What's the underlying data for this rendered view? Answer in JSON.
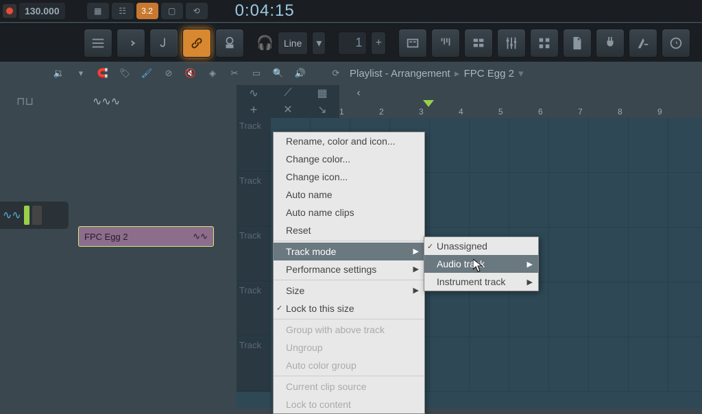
{
  "topbar": {
    "tempo": "130.000",
    "time_display": "0:04:15",
    "pattern_btn": "3.2"
  },
  "toolbar": {
    "line_mode": "Line",
    "pattern_number": "1",
    "plus": "+"
  },
  "subheader": {
    "title_prefix": "Playlist - Arrangement",
    "title_clip": "FPC Egg 2"
  },
  "clip": {
    "name": "FPC Egg 2"
  },
  "ruler": {
    "ticks": [
      "1",
      "2",
      "3",
      "4",
      "5",
      "6",
      "7",
      "8",
      "9"
    ]
  },
  "tracks": {
    "label": "Track"
  },
  "context_menu": {
    "rename": "Rename, color and icon...",
    "change_color": "Change color...",
    "change_icon": "Change icon...",
    "auto_name": "Auto name",
    "auto_name_clips": "Auto name clips",
    "reset": "Reset",
    "track_mode": "Track mode",
    "performance": "Performance settings",
    "size": "Size",
    "lock_size": "Lock to this size",
    "group_above": "Group with above track",
    "ungroup": "Ungroup",
    "auto_color_group": "Auto color group",
    "current_clip": "Current clip source",
    "lock_content": "Lock to content"
  },
  "submenu": {
    "unassigned": "Unassigned",
    "audio_track": "Audio track",
    "instrument_track": "Instrument track"
  }
}
